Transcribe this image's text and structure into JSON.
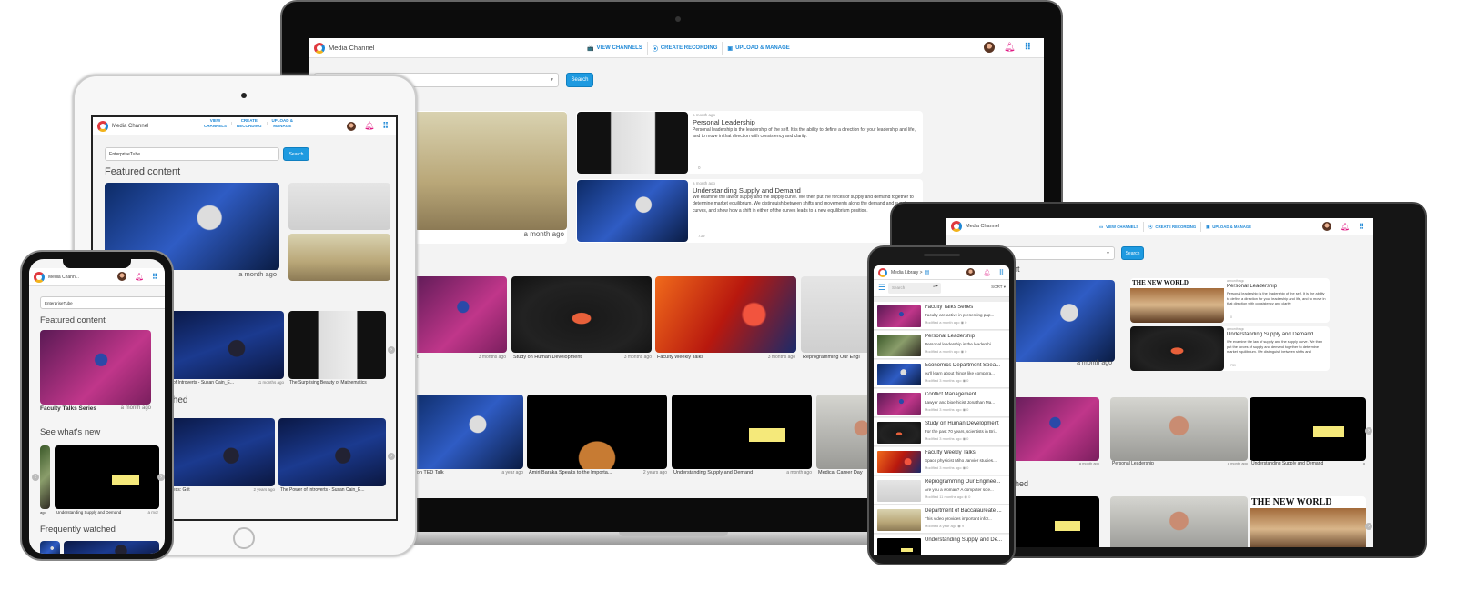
{
  "app": {
    "title": "Media Channel",
    "title_truncated": "Media Chann...",
    "accent_color": "#1e9ae0",
    "notification_color": "#e01b84"
  },
  "nav": {
    "view_channels": "VIEW CHANNELS",
    "create_recording": "CREATE RECORDING",
    "upload_manage": "UPLOAD & MANAGE",
    "view_channels_l1": "VIEW",
    "view_channels_l2": "CHANNELS",
    "create_recording_l1": "CREATE",
    "create_recording_l2": "RECORDING",
    "upload_manage_l1": "UPLOAD &",
    "upload_manage_l2": "MANAGE"
  },
  "search": {
    "channel_value": "EnterpriseTube",
    "button_label": "Search"
  },
  "sections": {
    "featured": "Featured content",
    "whats_new": "See what's new",
    "frequently_watched": "Frequently watched",
    "featured_partial": "ent",
    "whats_new_partial": "w",
    "frequently_partial_laptop": "d",
    "frequently_partial_tablet": "tched"
  },
  "laptop": {
    "featured_time": "a month ago",
    "cards": [
      {
        "time": "a month ago",
        "title": "Personal Leadership",
        "description": "Personal leadership is the leadership of the self. It is the ability to define a direction for your leadership and life, and to move in that direction with consistency and clarity.",
        "views": "0"
      },
      {
        "time": "a month ago",
        "title": "Understanding Supply and Demand",
        "description": "We examine the law of supply and the supply curve. We then put the forces of supply and demand together to determine market equilibrium. We distinguish between shifts and movements along the demand and supply curves, and show how a shift in either of the curves leads to a new equilibrium position.",
        "views": "739"
      }
    ],
    "whats_new": [
      {
        "title": "ent",
        "time": "3 months ago"
      },
      {
        "title": "Study on Human Development",
        "time": "3 months ago"
      },
      {
        "title": "Faculty Weekly Talks",
        "time": "3 months ago"
      },
      {
        "title": "Reprogramming Our Engi",
        "time": ""
      }
    ],
    "frequently": [
      {
        "title": "nson TED Talk",
        "time": "a year ago"
      },
      {
        "title": "Amiri Baraka Speaks to the Importa...",
        "time": "2 years ago"
      },
      {
        "title": "Understanding Supply and Demand",
        "time": "a month ago"
      },
      {
        "title": "Medical Career Day",
        "time": ""
      }
    ]
  },
  "tablet_left": {
    "featured_time": "a month ago",
    "row1": [
      {
        "title": "of Introverts - Susan Cain_E...",
        "time": "11 months ago"
      },
      {
        "title": "The Surprising Beauty of Mathematics",
        "time": ""
      }
    ],
    "row2": [
      {
        "title": "ess: Grit",
        "time": "2 years ago"
      },
      {
        "title": "The Power of Introverts - Susan Cain_E...",
        "time": ""
      }
    ]
  },
  "iphone": {
    "featured_title": "Faculty Talks Series",
    "featured_time": "a month ago",
    "whats_new_prev_time": "ago",
    "whats_new_title": "Understanding Supply and Demand",
    "whats_new_time": "a mor"
  },
  "android_phone": {
    "breadcrumb": "Media Library >",
    "search_placeholder": "Search",
    "sort_label": "SORT",
    "items": [
      {
        "title": "Faculty Talks Series",
        "description": "Faculty are active in presenting pap...",
        "meta": "Modified a month ago  ◉ 0",
        "theme": "t-purple"
      },
      {
        "title": "Personal Leadership",
        "description": "Personal leadership is the leadershi...",
        "meta": "Modified a month ago  ◉ 0",
        "theme": "t-green"
      },
      {
        "title": "Economics Department Spea...",
        "description": "ou'll learn about things like compara...",
        "meta": "Modified 3 months ago  ◉ 0",
        "theme": "t-ted"
      },
      {
        "title": "Conflict Management",
        "description": "Lawyer and bioethicist Jonathan Ma...",
        "meta": "Modified 3 months ago  ◉ 0",
        "theme": "t-purple"
      },
      {
        "title": "Study on Human Development",
        "description": "For the past 70 years, scientists in Bri...",
        "meta": "Modified 3 months ago  ◉ 0",
        "theme": "t-dark"
      },
      {
        "title": "Faculty Weekly Talks",
        "description": "Space physicist Miho Janvier studies...",
        "meta": "Modified 3 months ago  ◉ 0",
        "theme": "t-red"
      },
      {
        "title": "Reprogramming Our Enginee...",
        "description": "Are you a woman? A computer scie...",
        "meta": "Modified 11 months ago  ◉ 0",
        "theme": "t-light"
      },
      {
        "title": "Department of Baccalaureate ...",
        "description": "This video provides important infor...",
        "meta": "Modified a year ago  ◉ 9",
        "theme": "t-room"
      },
      {
        "title": "Understanding Supply and De...",
        "description": "",
        "meta": "",
        "theme": "t-chart"
      }
    ]
  },
  "tablet_right": {
    "featured_time": "a month ago",
    "new_world_text": "THE NEW WORLD",
    "cards": [
      {
        "time": "a month ago",
        "title": "Personal Leadership",
        "description": "Personal leadership is the leadership of the self. It is the ability to define a direction for your leadership and life, and to move in that direction with consistency and clarity.",
        "views": "0"
      },
      {
        "time": "a month ago",
        "title": "Understanding Supply and Demand",
        "description": "We examine the law of supply and the supply curve. We then put the forces of supply and demand together to determine market equilibrium. We distinguish between shifts and",
        "views": "739"
      }
    ],
    "whats_new": [
      {
        "title": "",
        "time": "a month ago"
      },
      {
        "title": "Personal Leadership",
        "time": "a month ago"
      },
      {
        "title": "Understanding Supply and Demand",
        "time": "a"
      }
    ]
  }
}
